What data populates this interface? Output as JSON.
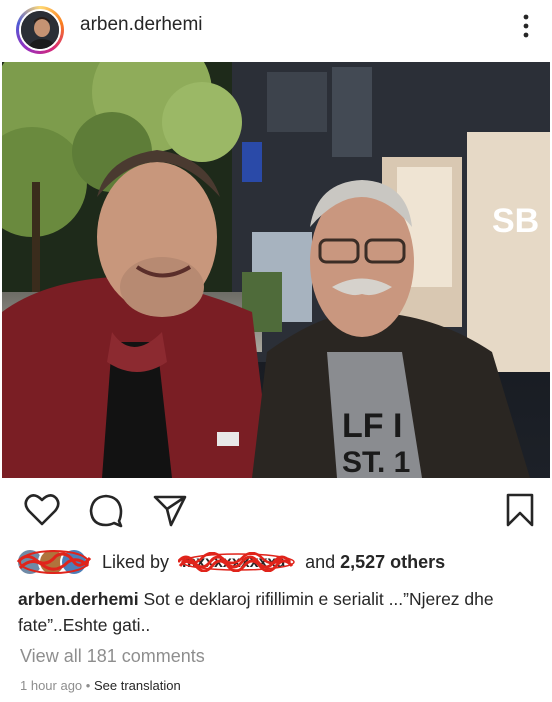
{
  "post": {
    "username": "arben.derhemi",
    "icons": {
      "more": "more-vertical-icon",
      "like": "heart-icon",
      "comment": "comment-icon",
      "share": "send-icon",
      "save": "bookmark-icon"
    },
    "likes": {
      "prefix": "Liked by",
      "conjunction": "and",
      "count": "2,527 others"
    },
    "caption": {
      "username": "arben.derhemi",
      "text": "Sot e deklaroj rifillimin e serialit ...”Njerez dhe fate”..Eshte gati.."
    },
    "comments_link": "View all 181 comments",
    "time": "1 hour ago",
    "separator": "•",
    "see_translation": "See translation"
  }
}
